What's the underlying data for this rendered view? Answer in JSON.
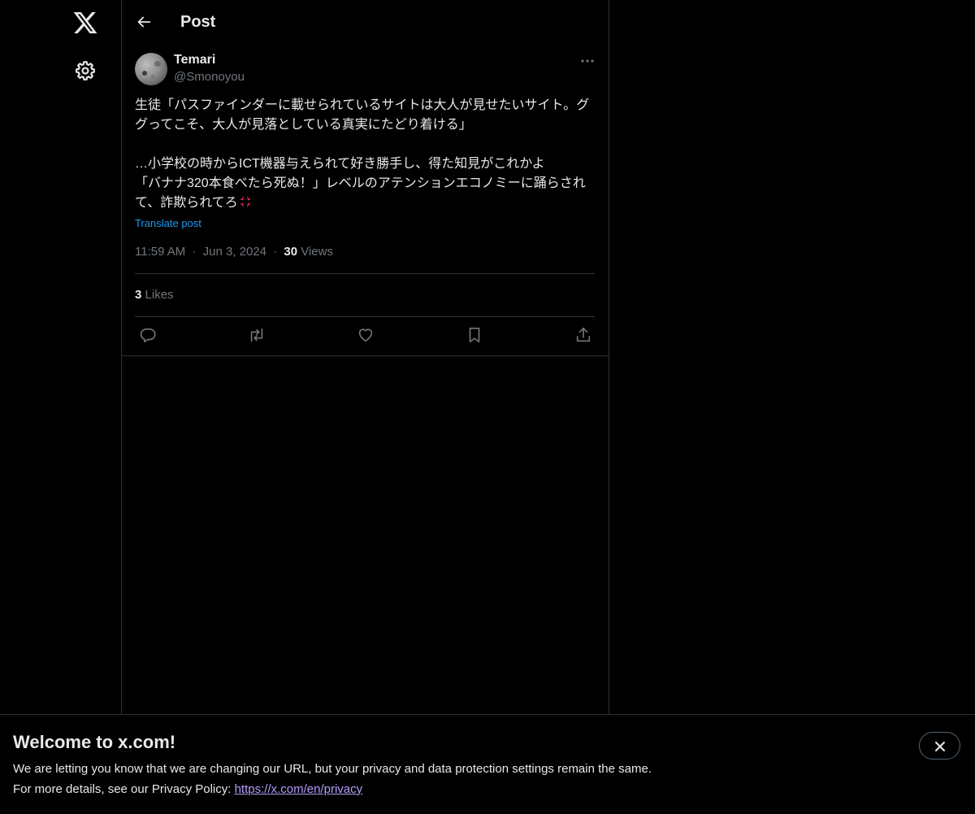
{
  "nav": {
    "logo_icon": "x-logo-icon",
    "settings_icon": "gear-icon"
  },
  "header": {
    "title": "Post",
    "back_icon": "arrow-left-icon"
  },
  "post": {
    "author_name": "Temari",
    "author_handle": "@Smonoyou",
    "more_icon": "ellipsis-icon",
    "text_paragraph1": "生徒「パスファインダーに載せられているサイトは大人が見せたいサイト。ググってこそ、大人が見落としている真実にたどり着ける」",
    "text_paragraph2": "…小学校の時からICT機器与えられて好き勝手し、得た知見がこれかよ\n「バナナ320本食べたら死ぬ！」レベルのアテンションエコノミーに踊らされて、詐欺られてろ",
    "emoji_icon": "anger-symbol-icon",
    "translate_label": "Translate post",
    "time": "11:59 AM",
    "separator": "·",
    "date": "Jun 3, 2024",
    "views_count": "30",
    "views_label": "Views",
    "likes_count": "3",
    "likes_label": "Likes"
  },
  "actions": [
    "reply-icon",
    "repost-icon",
    "like-icon",
    "bookmark-icon",
    "share-icon"
  ],
  "banner": {
    "title": "Welcome to x.com!",
    "line1": "We are letting you know that we are changing our URL, but your privacy and data protection settings remain the same.",
    "line2_prefix": "For more details, see our Privacy Policy: ",
    "link": "https://x.com/en/privacy",
    "close_icon": "close-icon"
  },
  "colors": {
    "background": "#000000",
    "text": "#e7e9ea",
    "secondary": "#71767b",
    "accent": "#1d9bf0",
    "border": "#2f3336",
    "link_visited": "#b39dfb"
  }
}
